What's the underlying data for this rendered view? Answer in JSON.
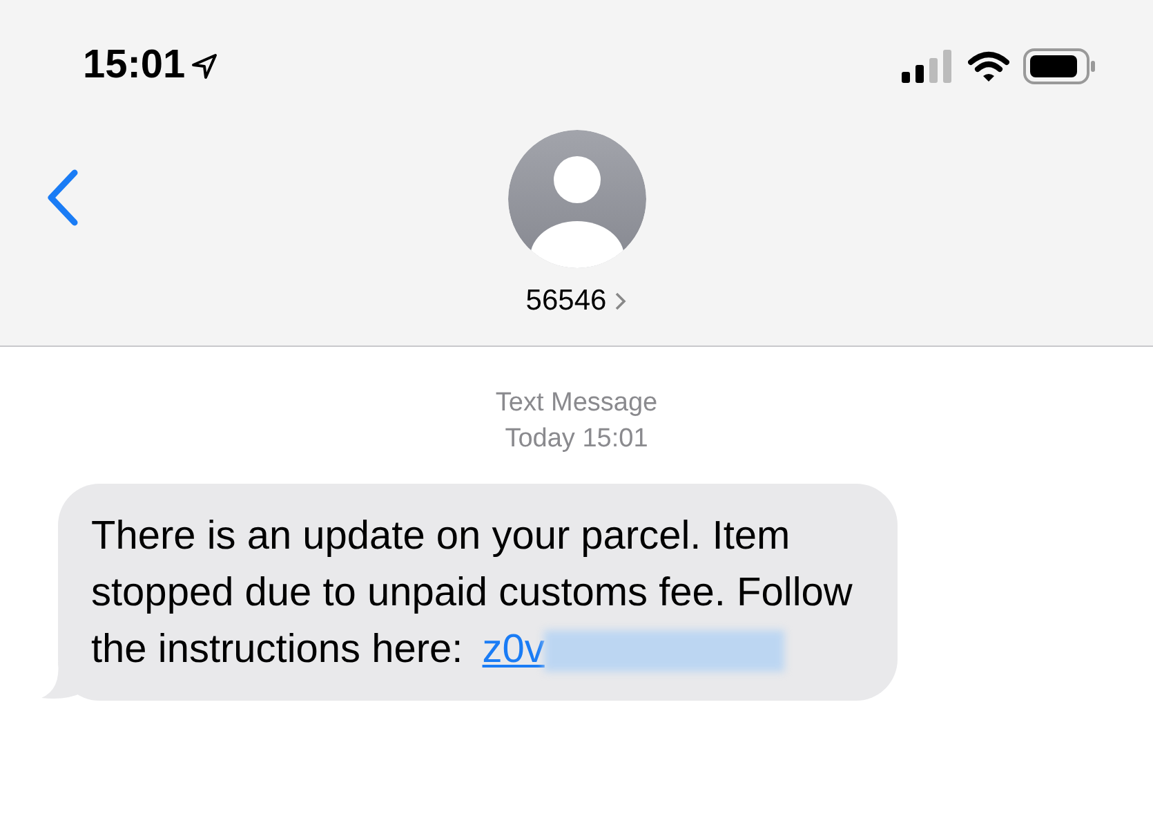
{
  "status_bar": {
    "time": "15:01"
  },
  "header": {
    "contact": "56546"
  },
  "timestamp": {
    "label": "Text Message",
    "time": "Today 15:01"
  },
  "messages": [
    {
      "text": "There is an update on your parcel. Item stopped due to unpaid customs fee. Follow the instructions here:",
      "link": "z0v",
      "redacted": true
    }
  ]
}
